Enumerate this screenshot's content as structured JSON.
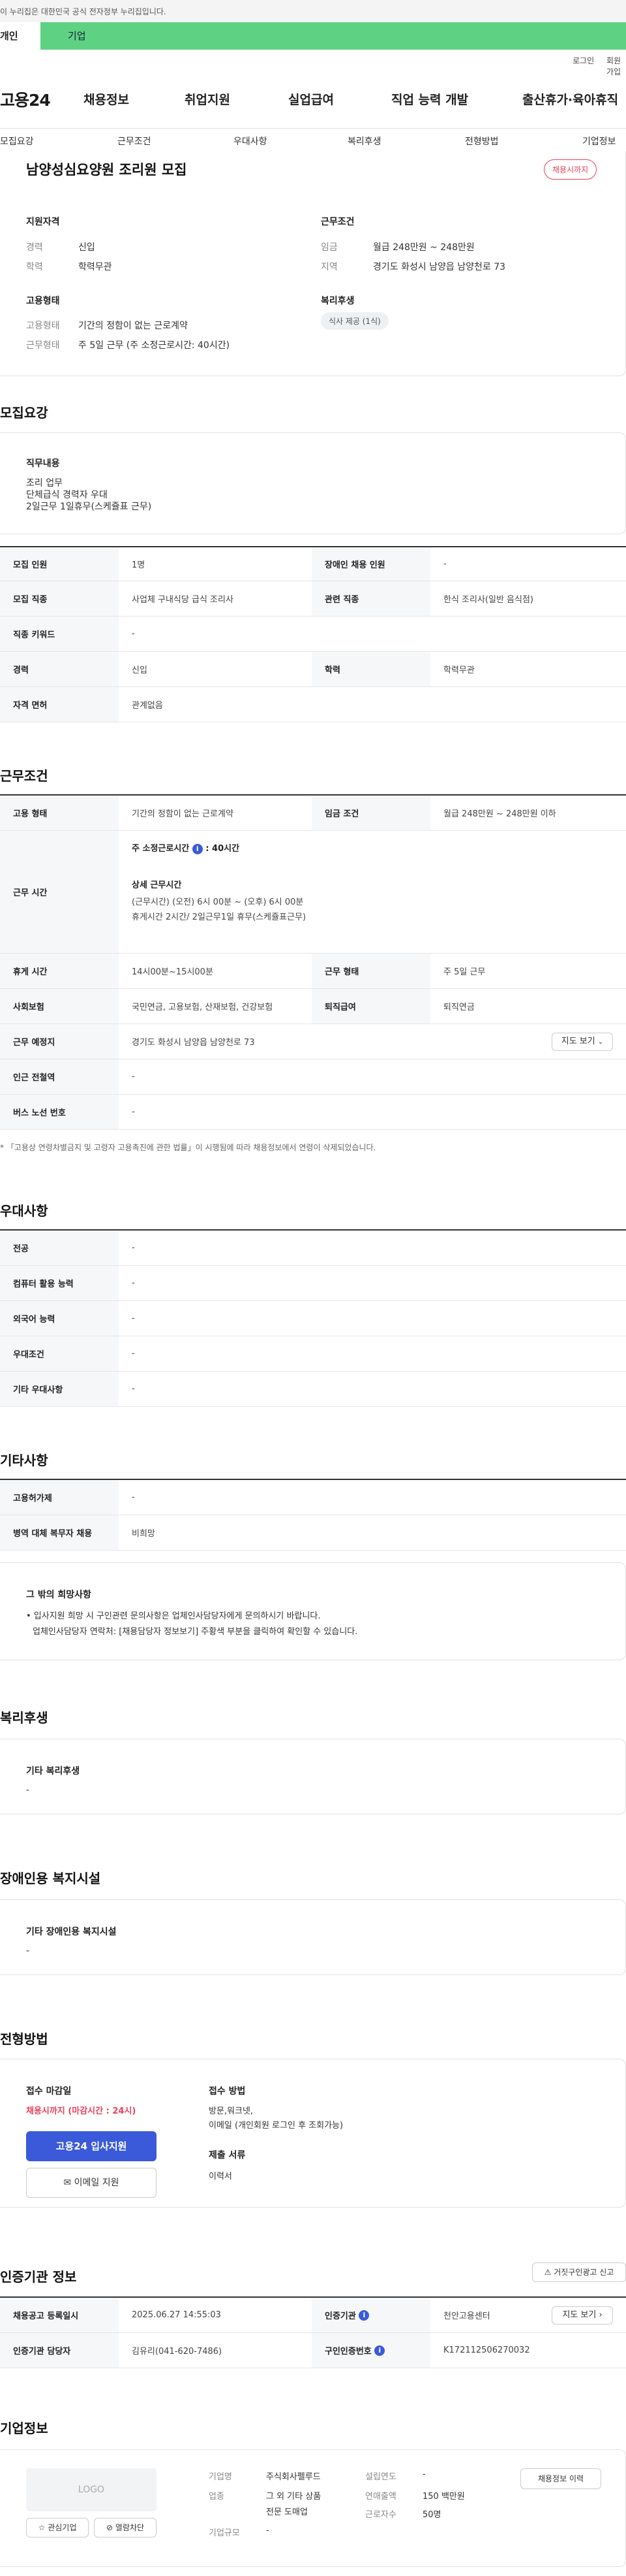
{
  "gov_notice": "이 누리집은 대한민국 공식 전자정부 누리집입니다.",
  "site_tabs": [
    "개인",
    "기업"
  ],
  "util_links": [
    "로그인",
    "회원가입"
  ],
  "logo": "고용24",
  "gnb": [
    "채용정보",
    "취업지원",
    "실업급여",
    "직업 능력 개발",
    "출산휴가·육아휴직"
  ],
  "subnav": [
    "모집요강",
    "근무조건",
    "우대사항",
    "복리후생",
    "전형방법",
    "기업정보"
  ],
  "summary": {
    "title": "남양성심요양원 조리원 모집",
    "status_badge": "채용시까지",
    "qual_title": "지원자격",
    "career_label": "경력",
    "career_value": "신입",
    "edu_label": "학력",
    "edu_value": "학력무관",
    "cond_title": "근무조건",
    "wage_label": "임금",
    "wage_value": "월급 248만원 ~ 248만원",
    "region_label": "지역",
    "region_value": "경기도 화성시 남양읍 남양천로 73",
    "emp_title": "고용형태",
    "emptype_label": "고용형태",
    "emptype_value": "기간의 정함이 없는 근로계약",
    "worktype_label": "근무형태",
    "worktype_value": "주 5일 근무 (주 소정근로시간: 40시간)",
    "welfare_title": "복리후생",
    "welfare_tag": "식사 제공 (1식)"
  },
  "recruit": {
    "section_title": "모집요강",
    "duty_title": "직무내용",
    "duty_lines": [
      "조리 업무",
      "단체급식 경력자 우대",
      "2일근무 1일휴무(스케쥴표 근무)"
    ],
    "rows": {
      "headcount_label": "모집 인원",
      "headcount_value": "1명",
      "disabled_label": "장애인 채용 인원",
      "disabled_value": "-",
      "job_label": "모집 직종",
      "job_value": "사업체 구내식당 급식 조리사",
      "related_label": "관련 직종",
      "related_value": "한식 조리사(일반 음식점)",
      "keyword_label": "직종 키워드",
      "keyword_value": "-",
      "career_label": "경력",
      "career_value": "신입",
      "edu_label": "학력",
      "edu_value": "학력무관",
      "license_label": "자격 면허",
      "license_value": "관계없음"
    }
  },
  "conditions": {
    "section_title": "근무조건",
    "emptype_label": "고용 형태",
    "emptype_value": "기간의 정함이 없는 근로계약",
    "wage_label": "임금 조건",
    "wage_value": "월급 248만원 ~ 248만원 이하",
    "hours_label": "근무 시간",
    "hours_main": "주 소정근로시간",
    "hours_main_value": ": 40시간",
    "hours_detail_title": "상세 근무시간",
    "hours_detail_1": "(근무시간) (오전) 6시 00분 ~ (오후) 6시 00분",
    "hours_detail_2": "휴게시간 2시간/ 2일근무1일 휴무(스케쥴표근무)",
    "break_label": "휴게 시간",
    "break_value": "14시00분~15시00분",
    "worktype_label": "근무 형태",
    "worktype_value": "주 5일 근무",
    "insurance_label": "사회보험",
    "insurance_value": "국민연금, 고용보험, 산재보험, 건강보험",
    "severance_label": "퇴직급여",
    "severance_value": "퇴직연금",
    "place_label": "근무 예정지",
    "place_value": "경기도 화성시 남양읍 남양천로 73",
    "map_button": "지도 보기",
    "station_label": "인근 전철역",
    "station_value": "-",
    "bus_label": "버스 노선 번호",
    "bus_value": "-",
    "note": "* 「고용상 연령차별금지 및 고령자 고용촉진에 관한 법률」이 시행됨에 따라 채용정보에서 연령이 삭제되었습니다."
  },
  "preference": {
    "section_title": "우대사항",
    "major_label": "전공",
    "major_value": "-",
    "computer_label": "컴퓨터 활용 능력",
    "computer_value": "-",
    "lang_label": "외국어 능력",
    "lang_value": "-",
    "pref_label": "우대조건",
    "pref_value": "-",
    "etc_label": "기타 우대사항",
    "etc_value": "-"
  },
  "other": {
    "section_title": "기타사항",
    "permit_label": "고용허가제",
    "permit_value": "-",
    "military_label": "병역 대체 복무자 채용",
    "military_value": "비희망",
    "hope_title": "그 밖의 희망사항",
    "hope_1": "• 입사지원 희망 시 구인관련 문의사항은 업체인사담당자에게 문의하시기 바랍니다.",
    "hope_2": "업체인사담당자 연락처: [채용담당자 정보보기] 주황색 부분을 클릭하여 확인할 수 있습니다."
  },
  "welfare": {
    "section_title": "복리후생",
    "etc_title": "기타 복리후생",
    "etc_value": "-"
  },
  "disability": {
    "section_title": "장애인용 복지시설",
    "etc_title": "기타 장애인용 복지시설",
    "etc_value": "-"
  },
  "process": {
    "section_title": "전형방법",
    "deadline_title": "접수 마감일",
    "deadline_value": "채용시까지 (마감시간 : 24시)",
    "apply_button": "고용24 입사지원",
    "email_button": "이메일 지원",
    "method_title": "접수 방법",
    "method_value_1": "방문,워크넷,",
    "method_value_2": "이메일 (개인회원 로그인 후 조회가능)",
    "docs_title": "제출 서류",
    "docs_value": "이력서"
  },
  "cert": {
    "section_title": "인증기관 정보",
    "report_button": "거짓구인광고 신고",
    "reg_label": "채용공고 등록일시",
    "reg_value": "2025.06.27 14:55:03",
    "org_label": "인증기관",
    "org_value": "천안고용센터",
    "map_button": "지도 보기",
    "manager_label": "인증기관 담당자",
    "manager_value": "김유리(041-620-7486)",
    "regno_label": "구인인증번호",
    "regno_value": "K172112506270032"
  },
  "company": {
    "section_title": "기업정보",
    "logo_text": "LOGO",
    "fav_button": "관심기업",
    "block_button": "열람차단",
    "name_label": "기업명",
    "name_value": "주식회사펠루드",
    "industry_label": "업종",
    "industry_value_1": "그 외 기타 상품",
    "industry_value_2": "전문 도매업",
    "size_label": "기업규모",
    "size_value": "-",
    "year_label": "설립연도",
    "year_value": "-",
    "sales_label": "연매출액",
    "sales_value": "150 백만원",
    "staff_label": "근로자수",
    "staff_value": "50명",
    "history_button": "채용정보 이력"
  }
}
